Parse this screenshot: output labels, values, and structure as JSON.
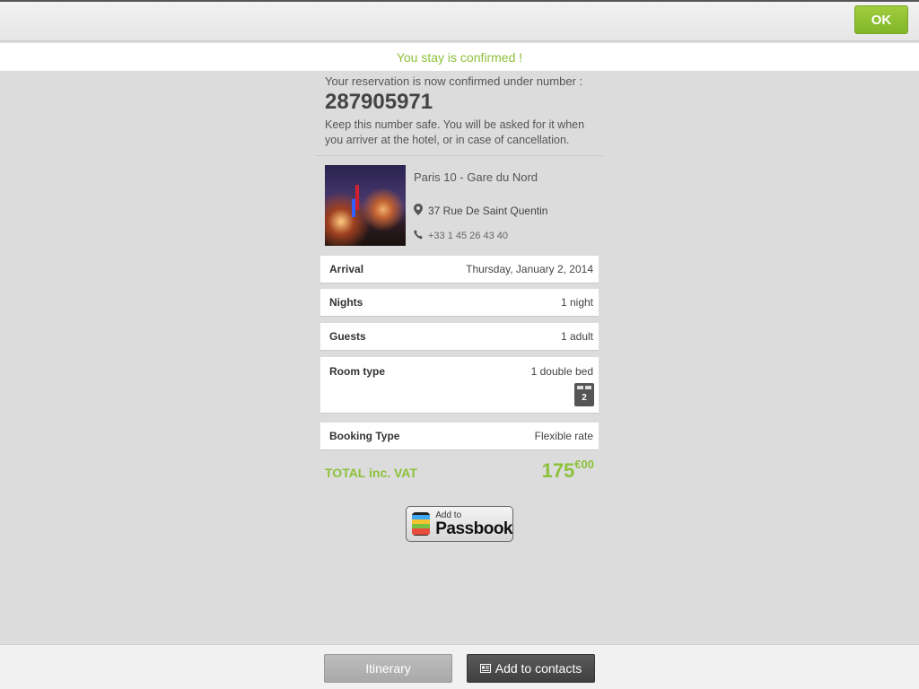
{
  "toolbar": {
    "ok_label": "OK"
  },
  "banner": {
    "message": "You stay is confirmed !"
  },
  "reservation": {
    "intro": "Your reservation is now confirmed under number :",
    "number": "287905971",
    "note": "Keep this number safe. You will be asked for it when you arriver at the hotel, or in case of cancellation."
  },
  "hotel": {
    "name": "Paris 10 - Gare du Nord",
    "address": "37 Rue De Saint Quentin",
    "phone": "+33 1 45 26 43 40",
    "icons": {
      "address": "map-pin-icon",
      "phone": "phone-icon"
    }
  },
  "details": {
    "arrival": {
      "label": "Arrival",
      "value": "Thursday, January 2, 2014"
    },
    "nights": {
      "label": "Nights",
      "value": "1 night"
    },
    "guests": {
      "label": "Guests",
      "value": "1 adult"
    },
    "room": {
      "label": "Room type",
      "value": "1 double bed",
      "bed_count": "2",
      "icon": "double-bed-icon"
    },
    "booking": {
      "label": "Booking Type",
      "value": "Flexible rate"
    }
  },
  "total": {
    "label": "TOTAL inc. VAT",
    "amount": "175",
    "cents": "€00"
  },
  "passbook": {
    "small": "Add to",
    "big": "Passbook"
  },
  "footer": {
    "itinerary_label": "Itinerary",
    "contacts_label": "Add to contacts",
    "contacts_icon": "contact-card-icon"
  },
  "colors": {
    "accent": "#8dc13a",
    "dark_button": "#404040",
    "background": "#dcdcdc"
  }
}
